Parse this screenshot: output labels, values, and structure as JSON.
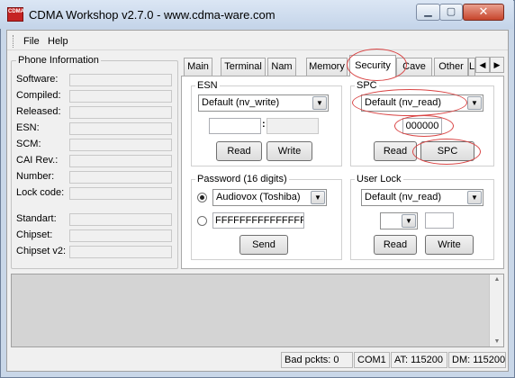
{
  "window": {
    "title": "CDMA Workshop v2.7.0  -  www.cdma-ware.com",
    "icon_text": "CDMA",
    "minimize_glyph": "▁",
    "maximize_glyph": "▢",
    "close_glyph": "✕"
  },
  "menu": {
    "file": "File",
    "help": "Help"
  },
  "phone_info": {
    "title": "Phone Information",
    "labels": {
      "software": "Software:",
      "compiled": "Compiled:",
      "released": "Released:",
      "esn": "ESN:",
      "scm": "SCM:",
      "cai_rev": "CAI Rev.:",
      "number": "Number:",
      "lock_code": "Lock code:",
      "standart": "Standart:",
      "chipset": "Chipset:",
      "chipset_v2": "Chipset v2:"
    }
  },
  "tabs": [
    "Main",
    "Terminal",
    "Nam",
    "Memory",
    "Security",
    "Cave",
    "Other",
    "L"
  ],
  "active_tab": "Security",
  "tab_scroll": {
    "left": "◀",
    "right": "▶"
  },
  "security": {
    "esn": {
      "title": "ESN",
      "mode": "Default (nv_write)",
      "separator": ":",
      "read_button": "Read",
      "write_button": "Write"
    },
    "spc": {
      "title": "SPC",
      "mode": "Default (nv_read)",
      "value": "000000",
      "read_button": "Read",
      "spc_button": "SPC"
    },
    "password": {
      "title": "Password (16 digits)",
      "preset": "Audiovox (Toshiba)",
      "custom_value": "FFFFFFFFFFFFFFFF",
      "send_button": "Send"
    },
    "user_lock": {
      "title": "User Lock",
      "mode": "Default (nv_read)",
      "read_button": "Read",
      "write_button": "Write"
    }
  },
  "status_bar": {
    "bad_packets": "Bad pckts: 0",
    "port": "COM1",
    "at": "AT: 115200",
    "dm": "DM: 115200"
  },
  "colors": {
    "annotation": "#d94545",
    "title_bar": "#c9d7e8"
  }
}
